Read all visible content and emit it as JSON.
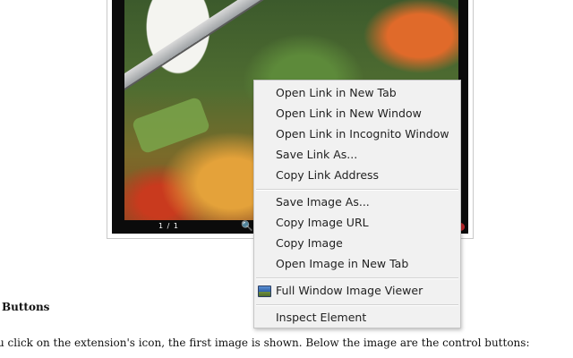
{
  "viewer": {
    "counter": "1 / 1",
    "zoom_icon": "magnifier-icon"
  },
  "page": {
    "heading": "Buttons",
    "paragraph": "u click on the extension's icon, the first image is shown. Below the image are the control buttons:"
  },
  "context_menu": {
    "items": [
      {
        "label": "Open Link in New Tab"
      },
      {
        "label": "Open Link in New Window"
      },
      {
        "label": "Open Link in Incognito Window"
      },
      {
        "label": "Save Link As..."
      },
      {
        "label": "Copy Link Address"
      },
      {
        "label": "Save Image As..."
      },
      {
        "label": "Copy Image URL"
      },
      {
        "label": "Copy Image"
      },
      {
        "label": "Open Image in New Tab"
      },
      {
        "label": "Full Window Image Viewer",
        "icon": "image-viewer-icon"
      },
      {
        "label": "Inspect Element"
      }
    ]
  }
}
